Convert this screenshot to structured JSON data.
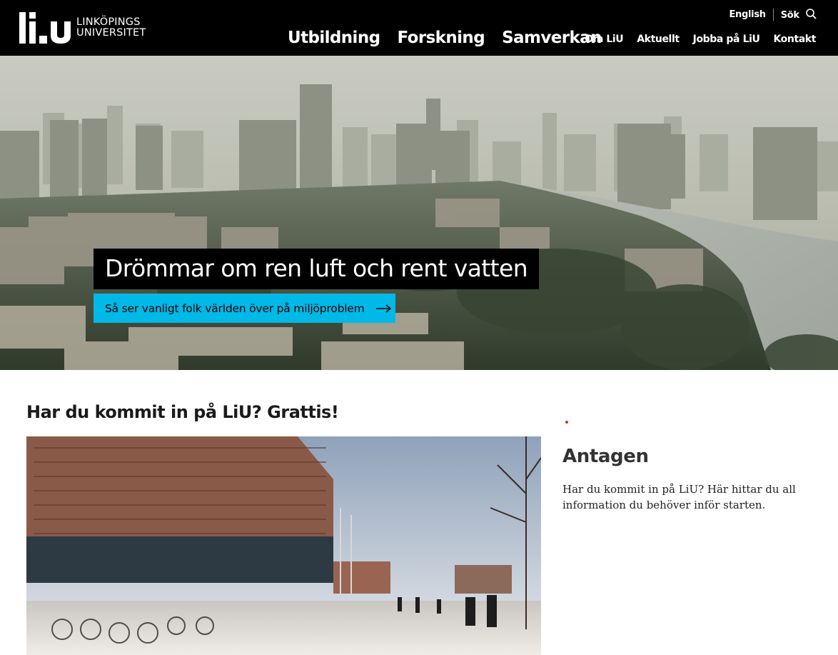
{
  "header": {
    "logo": {
      "line1": "LINKÖPINGS",
      "line2": "UNIVERSITET",
      "mark_text": "liu"
    },
    "main_nav": [
      {
        "label": "Utbildning"
      },
      {
        "label": "Forskning"
      },
      {
        "label": "Samverkan"
      }
    ],
    "utility": {
      "language": "English",
      "search_label": "Sök",
      "search_icon": "search-icon"
    },
    "secondary_nav": [
      {
        "label": "Om LiU"
      },
      {
        "label": "Aktuellt"
      },
      {
        "label": "Jobba på LiU"
      },
      {
        "label": "Kontakt"
      }
    ]
  },
  "hero": {
    "title": "Drömmar om ren luft och rent vatten",
    "cta_label": "Så ser vanligt folk världen över på miljöproblem",
    "cta_icon": "arrow-right-icon"
  },
  "content": {
    "section_title": "Har du kommit in på LiU? Grattis!",
    "side_title": "Antagen",
    "side_text": "Har du kommit in på LiU? Här hittar du all information du behöver inför starten."
  },
  "colors": {
    "header_bg": "#000000",
    "cta_bg": "#00b9e7",
    "accent_dot": "#d92b2b"
  }
}
